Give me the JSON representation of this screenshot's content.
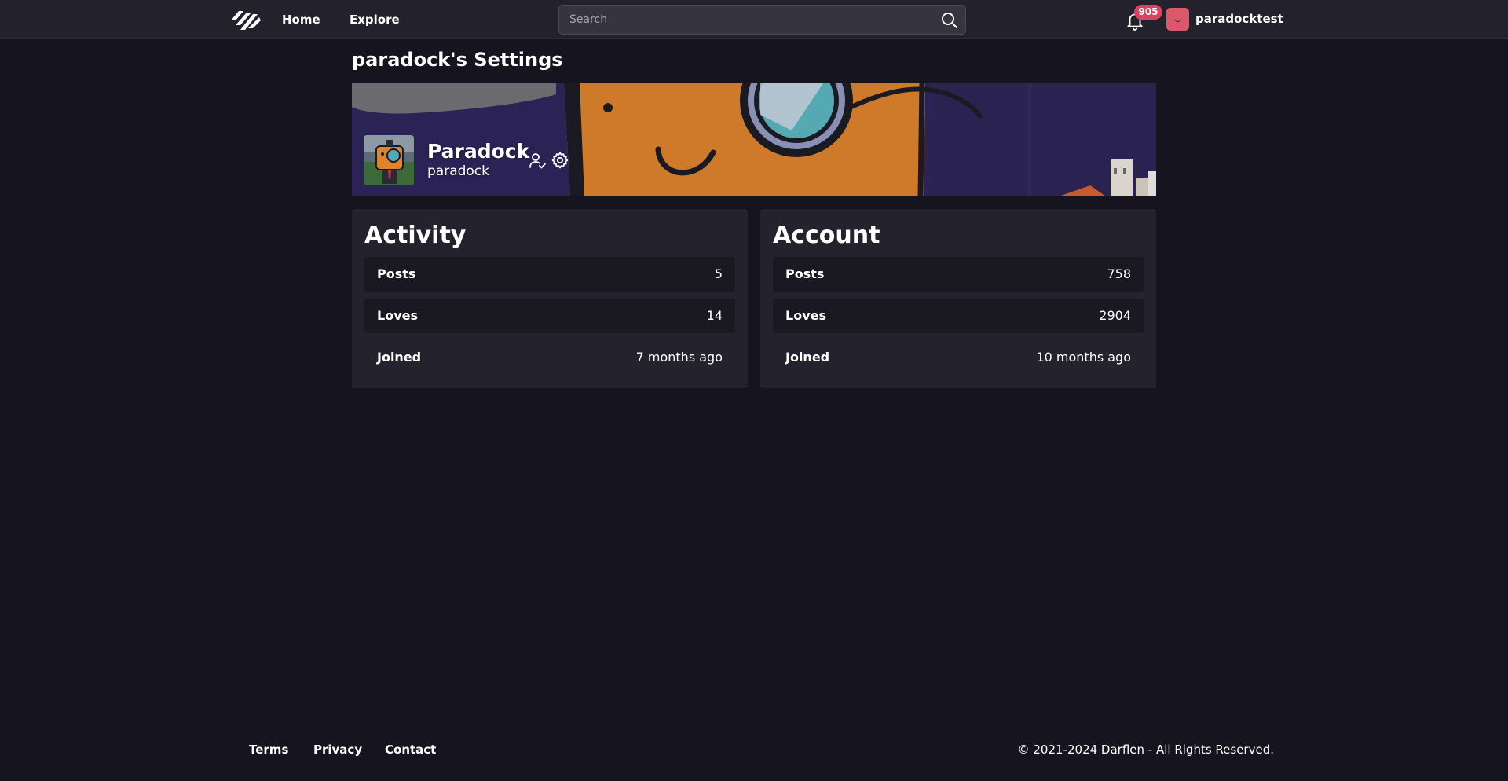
{
  "header": {
    "nav": {
      "home": "Home",
      "explore": "Explore"
    },
    "search": {
      "placeholder": "Search",
      "value": ""
    },
    "notifications": {
      "count": "905",
      "icon": "bell-icon"
    },
    "user": {
      "username": "paradocktest"
    }
  },
  "page": {
    "title": "paradock's Settings"
  },
  "profile": {
    "display_name": "Paradock",
    "handle": "paradock"
  },
  "activity": {
    "title": "Activity",
    "rows": [
      {
        "label": "Posts",
        "value": "5"
      },
      {
        "label": "Loves",
        "value": "14"
      },
      {
        "label": "Joined",
        "value": "7 months ago"
      }
    ]
  },
  "account": {
    "title": "Account",
    "rows": [
      {
        "label": "Posts",
        "value": "758"
      },
      {
        "label": "Loves",
        "value": "2904"
      },
      {
        "label": "Joined",
        "value": "10 months ago"
      }
    ]
  },
  "footer": {
    "links": {
      "terms": "Terms",
      "privacy": "Privacy",
      "contact": "Contact"
    },
    "copyright": "© 2021-2024 Darflen - All Rights Reserved."
  },
  "colors": {
    "background": "#16151f",
    "topbar": "#22212c",
    "card": "#23222d",
    "row_shaded": "#1a1921",
    "badge": "#d9455f",
    "avatar": "#d9596a"
  }
}
